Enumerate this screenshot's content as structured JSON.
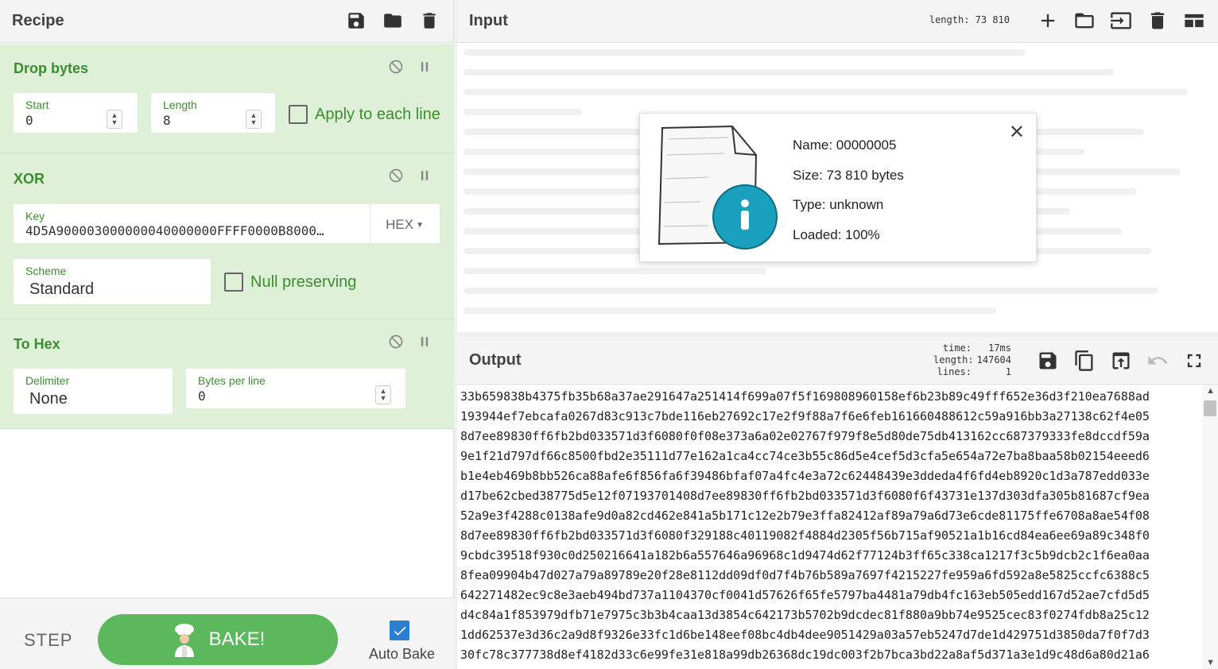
{
  "recipe": {
    "title": "Recipe",
    "icons": [
      "save-icon",
      "folder-icon",
      "trash-icon"
    ],
    "operations": {
      "drop_bytes": {
        "title": "Drop bytes",
        "start_label": "Start",
        "start_value": "0",
        "length_label": "Length",
        "length_value": "8",
        "apply_label": "Apply to each line"
      },
      "xor": {
        "title": "XOR",
        "key_label": "Key",
        "key_value": "4D5A900003000000040000000FFFF0000B8000…",
        "key_format": "HEX",
        "scheme_label": "Scheme",
        "scheme_value": "Standard",
        "null_label": "Null preserving"
      },
      "to_hex": {
        "title": "To Hex",
        "delimiter_label": "Delimiter",
        "delimiter_value": "None",
        "bpl_label": "Bytes per line",
        "bpl_value": "0"
      }
    }
  },
  "controls": {
    "step_label": "STEP",
    "bake_label": "BAKE!",
    "autobake_label": "Auto Bake",
    "autobake_checked": true
  },
  "input": {
    "title": "Input",
    "length_text": "length: 73 810",
    "file": {
      "name": "Name: 00000005",
      "size": "Size: 73 810 bytes",
      "type": "Type: unknown",
      "loaded": "Loaded: 100%"
    }
  },
  "output": {
    "title": "Output",
    "time_label": "time:",
    "time_value": "17ms",
    "length_label": "length:",
    "length_value": "147604",
    "lines_label": "lines:",
    "lines_value": "1",
    "lines": [
      "33b659838b4375fb35b68a37ae291647a251414f699a07f5f169808960158ef6b23b89c49fff652e36d3f210ea7688ad",
      "193944ef7ebcafa0267d83c913c7bde116eb27692c17e2f9f88a7f6e6feb161660488612c59a916bb3a27138c62f4e05",
      "8d7ee89830ff6fb2bd033571d3f6080f0f08e373a6a02e02767f979f8e5d80de75db413162cc687379333fe8dccdf59a",
      "9e1f21d797df66c8500fbd2e35111d77e162a1ca4cc74ce3b55c86d5e4cef5d3cfa5e654a72e7ba8baa58b02154eeed6",
      "b1e4eb469b8bb526ca88afe6f856fa6f39486bfaf07a4fc4e3a72c62448439e3ddeda4f6fd4eb8920c1d3a787edd033e",
      "d17be62cbed38775d5e12f07193701408d7ee89830ff6fb2bd033571d3f6080f6f43731e137d303dfa305b81687cf9ea",
      "52a9e3f4288c0138afe9d0a82cd462e841a5b171c12e2b79e3ffa82412af89a79a6d73e6cde81175ffe6708a8ae54f08",
      "8d7ee89830ff6fb2bd033571d3f6080f329188c40119082f4884d2305f56b715af90521a1b16cd84ea6ee69a89c348f0",
      "9cbdc39518f930c0d250216641a182b6a557646a96968c1d9474d62f77124b3ff65c338ca1217f3c5b9dcb2c1f6ea0aa",
      "8fea09904b47d027a79a89789e20f28e8112dd09df0d7f4b76b589a7697f4215227fe959a6fd592a8e5825ccfc6388c5",
      "642271482ec9c8e3aeb494bd737a1104370cf0041d57626f65fe5797ba4481a79db4fc163eb505edd167d52ae7cfd5d5",
      "d4c84a1f853979dfb71e7975c3b3b4caa13d3854c642173b5702b9dcdec81f880a9bb74e9525cec83f0274fdb8a25c12",
      "1dd62537e3d36c2a9d8f9326e33fc1d6be148eef08bc4db4dee9051429a03a57eb5247d7de1d429751d3850da7f0f7d3",
      "30fc78c377738d8ef4182d33c6e99fe31e818a99db26368dc19dc003f2b7bca3bd22a8af5d371a3e1d9c48d6a80d21a6"
    ]
  }
}
